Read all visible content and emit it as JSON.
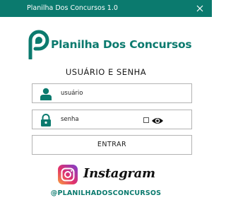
{
  "window": {
    "title": "Planilha Dos Concursos 1.0",
    "close_icon": "close-icon"
  },
  "brand": {
    "name": "Planilha Dos Concursos",
    "logo_icon": "p-logo-icon",
    "color": "#0b7a6e"
  },
  "login": {
    "heading": "USUÁRIO E SENHA",
    "user_field": {
      "value": "usuário",
      "icon": "user-icon"
    },
    "password_field": {
      "value": "senha",
      "icon": "lock-icon",
      "show_password_checked": false,
      "eye_icon": "eye-icon"
    },
    "enter_label": "ENTRAR"
  },
  "social": {
    "network": "Instagram",
    "icon": "instagram-icon",
    "handle": "@PLANILHADOSCONCURSOS"
  },
  "colors": {
    "titlebar": "#0b7a6e",
    "accent": "#0b7a6e",
    "field_border": "#b3b3b3"
  }
}
